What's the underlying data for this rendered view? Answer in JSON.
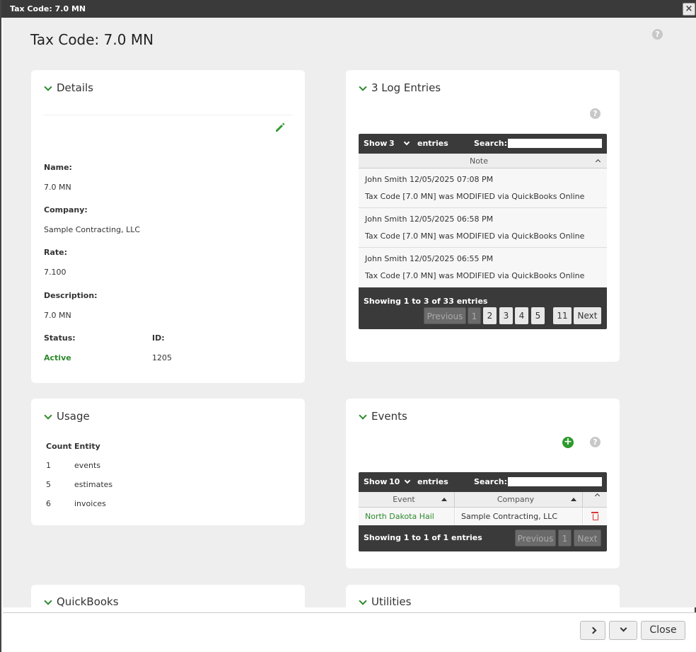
{
  "window": {
    "title": "Tax Code: 7.0 MN",
    "close_glyph": "×"
  },
  "page": {
    "title": "Tax Code: 7.0 MN",
    "help_glyph": "?"
  },
  "details": {
    "header": "Details",
    "fields": [
      {
        "label": "Name:",
        "value": "7.0 MN"
      },
      {
        "label": "Company:",
        "value": "Sample Contracting, LLC"
      },
      {
        "label": "Rate:",
        "value": "7.100"
      },
      {
        "label": "Description:",
        "value": "7.0 MN"
      }
    ],
    "status_label": "Status:",
    "status_value": "Active",
    "id_label": "ID:",
    "id_value": "1205",
    "status_color": "#2d8a2d"
  },
  "log": {
    "header": "3 Log Entries",
    "show": "Show",
    "length": "3",
    "entries": "entries",
    "search": "Search:",
    "col_note": "Note",
    "rows": [
      {
        "meta": "John Smith  12/05/2025 07:08 PM",
        "note": "Tax Code [7.0 MN] was MODIFIED via QuickBooks Online"
      },
      {
        "meta": "John Smith  12/05/2025 06:58 PM",
        "note": "Tax Code [7.0 MN] was MODIFIED via QuickBooks Online"
      },
      {
        "meta": "John Smith  12/05/2025 06:55 PM",
        "note": "Tax Code [7.0 MN] was MODIFIED via QuickBooks Online"
      }
    ],
    "info": "Showing 1 to 3 of 33 entries",
    "prev": "Previous",
    "pages": [
      "1",
      "2",
      "3",
      "4",
      "5"
    ],
    "last_page": "11",
    "next": "Next"
  },
  "usage": {
    "header": "Usage",
    "col_count": "Count",
    "col_entity": "Entity",
    "rows": [
      {
        "count": "1",
        "entity": "events"
      },
      {
        "count": "5",
        "entity": "estimates"
      },
      {
        "count": "6",
        "entity": "invoices"
      }
    ]
  },
  "events": {
    "header": "Events",
    "show": "Show",
    "length": "10",
    "entries": "entries",
    "search": "Search:",
    "col_event": "Event",
    "col_company": "Company",
    "rows": [
      {
        "event": "North Dakota Hail",
        "company": "Sample Contracting, LLC"
      }
    ],
    "info": "Showing 1 to 1 of 1 entries",
    "prev": "Previous",
    "page": "1",
    "next": "Next",
    "link_color": "#2d8a2d"
  },
  "quickbooks": {
    "header": "QuickBooks"
  },
  "utilities": {
    "header": "Utilities"
  },
  "footer": {
    "close": "Close"
  }
}
